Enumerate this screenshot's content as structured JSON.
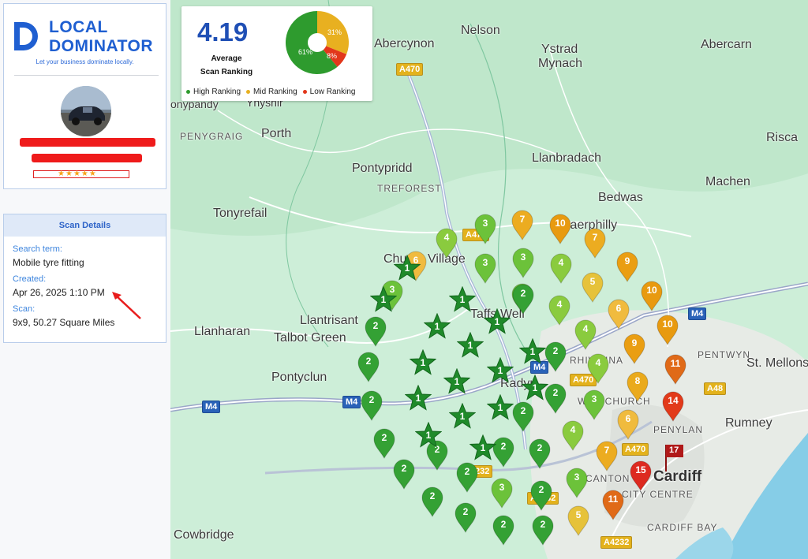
{
  "brand": {
    "word1": "LOCAL",
    "word2": "DOMINATOR",
    "tagline": "Let your business dominate locally.",
    "color": "#1f5fd1"
  },
  "profile": {
    "avatar_icon": "car-photo-avatar",
    "rating_stars": 5
  },
  "scan_details": {
    "title": "Scan Details",
    "search_label": "Search term:",
    "search_value": "Mobile tyre fitting",
    "created_label": "Created:",
    "created_value": "Apr 26, 2025 1:10 PM",
    "scan_label": "Scan:",
    "scan_value": "9x9, 50.27 Square Miles"
  },
  "stats": {
    "average": "4.19",
    "average_label_1": "Average",
    "average_label_2": "Scan Ranking",
    "high_pct": "61%",
    "mid_pct": "31%",
    "low_pct": "8%",
    "legend_high": "High Ranking",
    "legend_mid": "Mid Ranking",
    "legend_low": "Low Ranking",
    "colors": {
      "high": "#2e9b2e",
      "mid": "#e8b020",
      "low": "#e2371b"
    }
  },
  "map": {
    "places": [
      {
        "name": "Nelson"
      },
      {
        "name": "Ystrad"
      },
      {
        "name": "Mynach"
      },
      {
        "name": "Abercynon"
      },
      {
        "name": "Abercarn"
      },
      {
        "name": "onypandy"
      },
      {
        "name": "Ynyshir"
      },
      {
        "name": "PENYGRAIG"
      },
      {
        "name": "Porth"
      },
      {
        "name": "Risca"
      },
      {
        "name": "Pontypridd"
      },
      {
        "name": "TREFOREST"
      },
      {
        "name": "Llanbradach"
      },
      {
        "name": "Machen"
      },
      {
        "name": "Bedwas"
      },
      {
        "name": "Tonyrefail"
      },
      {
        "name": "Caerphilly"
      },
      {
        "name": "Church Village"
      },
      {
        "name": "Llanharan"
      },
      {
        "name": "Llantrisant"
      },
      {
        "name": "Talbot Green"
      },
      {
        "name": "Taffs Well"
      },
      {
        "name": "Pontyclun"
      },
      {
        "name": "PENTWYN"
      },
      {
        "name": "St. Mellons"
      },
      {
        "name": "RHIWBINA"
      },
      {
        "name": "WHITCHURCH"
      },
      {
        "name": "Radyr"
      },
      {
        "name": "Rumney"
      },
      {
        "name": "PENYLAN"
      },
      {
        "name": "Cardiff"
      },
      {
        "name": "CANTON"
      },
      {
        "name": "CITY CENTRE"
      },
      {
        "name": "CARDIFF BAY"
      },
      {
        "name": "Cowbridge"
      }
    ],
    "roads": [
      "A470",
      "A470",
      "M4",
      "M4",
      "M4",
      "M4",
      "A470",
      "A48",
      "A470",
      "A4232",
      "A4232",
      "A4232",
      "A48"
    ],
    "pins": [
      {
        "rank": "3",
        "tier": "high"
      },
      {
        "rank": "7",
        "tier": "mid"
      },
      {
        "rank": "10",
        "tier": "mid"
      },
      {
        "rank": "4",
        "tier": "high"
      },
      {
        "rank": "3",
        "tier": "high"
      },
      {
        "rank": "7",
        "tier": "mid"
      },
      {
        "rank": "6",
        "tier": "mid"
      },
      {
        "rank": "3",
        "tier": "high"
      },
      {
        "rank": "3",
        "tier": "high"
      },
      {
        "rank": "4",
        "tier": "high"
      },
      {
        "rank": "9",
        "tier": "mid"
      },
      {
        "rank": "5",
        "tier": "mid"
      },
      {
        "rank": "3",
        "tier": "high"
      },
      {
        "rank": "2",
        "tier": "high"
      },
      {
        "rank": "4",
        "tier": "high"
      },
      {
        "rank": "10",
        "tier": "mid"
      },
      {
        "rank": "6",
        "tier": "mid"
      },
      {
        "rank": "2",
        "tier": "high"
      },
      {
        "rank": "4",
        "tier": "high"
      },
      {
        "rank": "10",
        "tier": "mid"
      },
      {
        "rank": "9",
        "tier": "mid"
      },
      {
        "rank": "2",
        "tier": "high"
      },
      {
        "rank": "2",
        "tier": "high"
      },
      {
        "rank": "4",
        "tier": "high"
      },
      {
        "rank": "11",
        "tier": "low"
      },
      {
        "rank": "2",
        "tier": "high"
      },
      {
        "rank": "2",
        "tier": "high"
      },
      {
        "rank": "3",
        "tier": "high"
      },
      {
        "rank": "8",
        "tier": "mid"
      },
      {
        "rank": "14",
        "tier": "low"
      },
      {
        "rank": "2",
        "tier": "high"
      },
      {
        "rank": "6",
        "tier": "mid"
      },
      {
        "rank": "4",
        "tier": "high"
      },
      {
        "rank": "2",
        "tier": "high"
      },
      {
        "rank": "2",
        "tier": "high"
      },
      {
        "rank": "2",
        "tier": "high"
      },
      {
        "rank": "2",
        "tier": "high"
      },
      {
        "rank": "7",
        "tier": "mid"
      },
      {
        "rank": "2",
        "tier": "high"
      },
      {
        "rank": "2",
        "tier": "high"
      },
      {
        "rank": "3",
        "tier": "high"
      },
      {
        "rank": "2",
        "tier": "high"
      },
      {
        "rank": "3",
        "tier": "high"
      },
      {
        "rank": "15",
        "tier": "low"
      },
      {
        "rank": "2",
        "tier": "high"
      },
      {
        "rank": "11",
        "tier": "low"
      },
      {
        "rank": "2",
        "tier": "high"
      },
      {
        "rank": "2",
        "tier": "high"
      },
      {
        "rank": "2",
        "tier": "high"
      },
      {
        "rank": "5",
        "tier": "mid"
      }
    ],
    "stars": [
      "1",
      "1",
      "1",
      "1",
      "1",
      "1",
      "1",
      "1",
      "1",
      "1",
      "1",
      "1",
      "1",
      "1",
      "1",
      "1"
    ],
    "business_flag": "17"
  }
}
